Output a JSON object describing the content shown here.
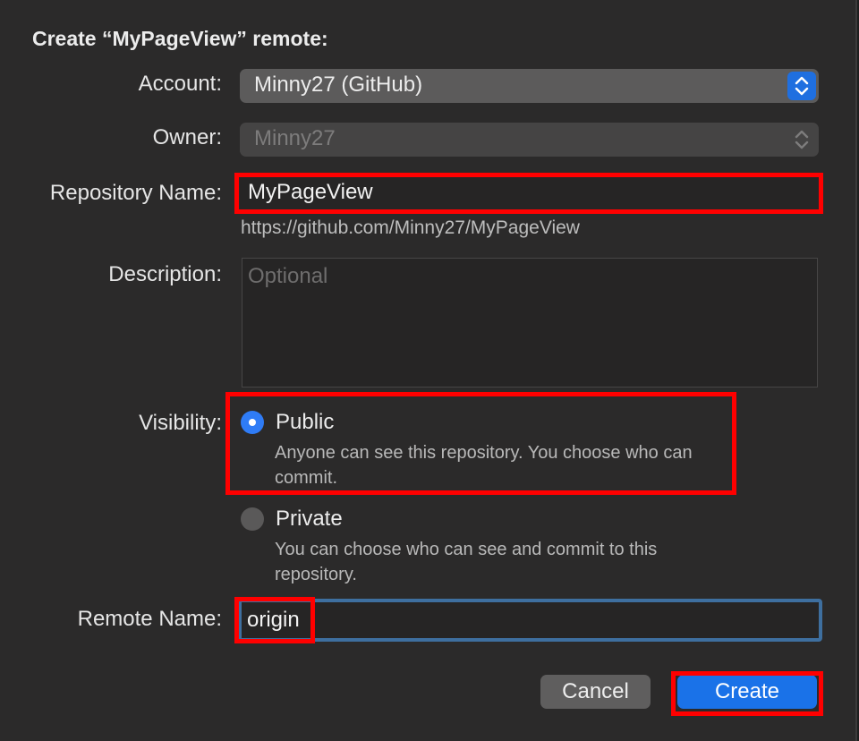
{
  "dialog": {
    "title": "Create “MyPageView” remote:"
  },
  "account": {
    "label": "Account:",
    "value": "Minny27 (GitHub)"
  },
  "owner": {
    "label": "Owner:",
    "value": "Minny27"
  },
  "repository": {
    "label": "Repository Name:",
    "value": "MyPageView",
    "url": "https://github.com/Minny27/MyPageView"
  },
  "description": {
    "label": "Description:",
    "placeholder": "Optional"
  },
  "visibility": {
    "label": "Visibility:",
    "options": [
      {
        "title": "Public",
        "desc": "Anyone can see this repository. You choose who can commit.",
        "selected": true
      },
      {
        "title": "Private",
        "desc": "You can choose who can see and commit to this repository.",
        "selected": false
      }
    ]
  },
  "remote": {
    "label": "Remote Name:",
    "value": "origin"
  },
  "buttons": {
    "cancel": "Cancel",
    "create": "Create"
  },
  "colors": {
    "accent": "#1a72e8",
    "highlight": "#ff0000",
    "background": "#2b2a2a"
  }
}
